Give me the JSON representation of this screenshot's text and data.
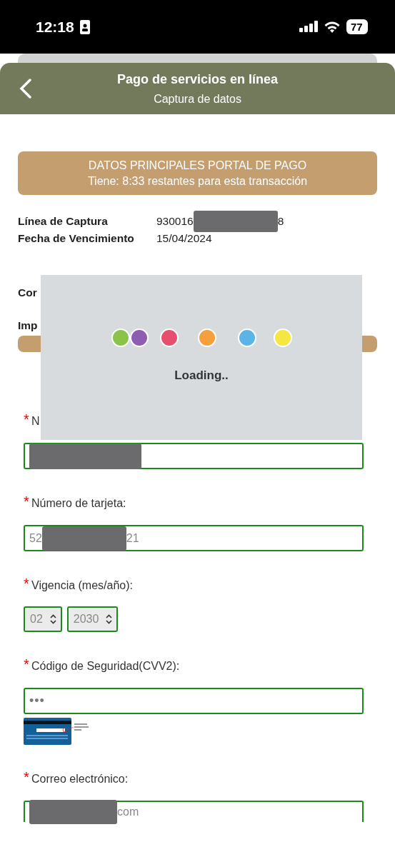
{
  "status_bar": {
    "time": "12:18",
    "battery": "77"
  },
  "header": {
    "title": "Pago de servicios en línea",
    "subtitle": "Captura de datos"
  },
  "banner": {
    "title": "DATOS PRINCIPALES PORTAL DE PAGO",
    "timer": "Tiene: 8:33 restantes para esta transacción"
  },
  "info": [
    {
      "label": "Línea de Captura",
      "value_start": "930016",
      "value_end": "8",
      "redacted": true
    },
    {
      "label": "Fecha de Vencimiento",
      "value_start": "15/04/2024",
      "redacted": false
    }
  ],
  "covered_labels": [
    "Cor",
    "Imp"
  ],
  "loading": {
    "text": "Loading..",
    "dots": [
      {
        "color": "#8bc34a"
      },
      {
        "color": "#8e5cb0"
      },
      {
        "color": "#e6506e"
      },
      {
        "color": "#f5a03c"
      },
      {
        "color": "#5ab4e6"
      },
      {
        "color": "#f5e642"
      }
    ]
  },
  "form": [
    {
      "kind": "text",
      "label": "N",
      "required_mark": "*",
      "redacted": true
    },
    {
      "kind": "text",
      "label": "Número de tarjeta:",
      "required_mark": "*",
      "value_start": "52",
      "value_end": "21",
      "redacted": true
    },
    {
      "kind": "selects",
      "label": "Vigencia (mes/año):",
      "required_mark": "*",
      "selects": [
        "02",
        "2030"
      ]
    },
    {
      "kind": "secret",
      "label": "Código de Seguridad(CVV2):",
      "required_mark": "*",
      "value_start": "•••",
      "redacted": false
    },
    {
      "kind": "text",
      "label": "Correo electrónico:",
      "required_mark": "*",
      "value_end": "com",
      "redacted": true,
      "cut": true
    }
  ]
}
